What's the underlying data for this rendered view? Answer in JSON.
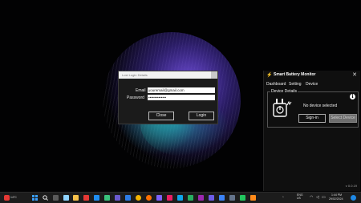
{
  "login_dialog": {
    "title": "Lost Login Details",
    "email_label": "Email",
    "email_value": "youremail@gmail.com",
    "password_label": "Password",
    "password_value": "••••••••••••••",
    "close_label": "Close",
    "login_label": "Login"
  },
  "battery_monitor": {
    "title": "Smart Battery Monitor",
    "close_glyph": "✕",
    "menu": [
      "Dashboard",
      "Setting",
      "Device"
    ],
    "group_label": "Device Details",
    "status_text": "No device selected",
    "info_glyph": "i",
    "signin_label": "Sign-in",
    "select_device_label": "Select Device",
    "version": "v 0.0.19"
  },
  "taskbar": {
    "weather_temp": "14°C",
    "language": "ENG\nUS",
    "time": "1:44 PM",
    "date": "29/02/2024"
  },
  "colors": {
    "accent_orange": "#ff8a1a",
    "select_device_button": "#6e6e6e"
  },
  "icons": [
    "wifi-icon",
    "volume-icon",
    "battery-icon",
    "windows-start-icon",
    "search-icon"
  ]
}
